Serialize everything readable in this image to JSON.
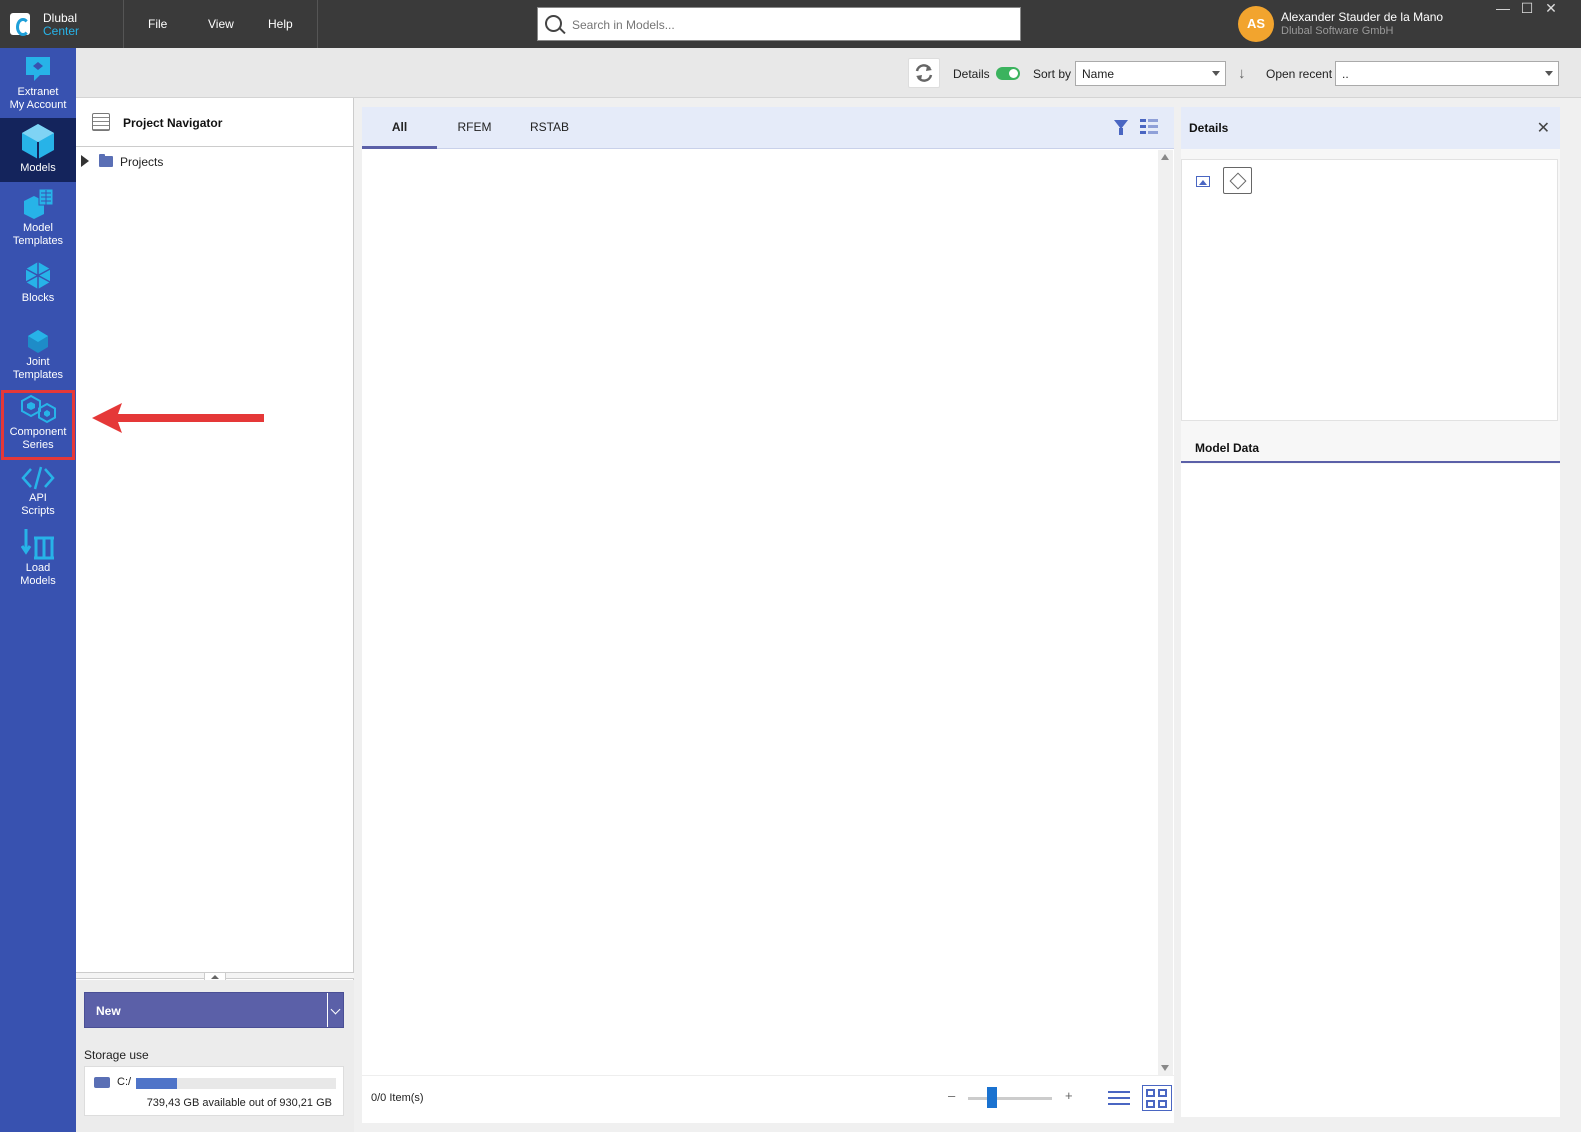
{
  "app": {
    "brand_line1": "Dlubal",
    "brand_line2": "Center"
  },
  "menu": {
    "items": [
      "File",
      "View",
      "Help"
    ]
  },
  "search": {
    "placeholder": "Search in Models...",
    "value": ""
  },
  "user": {
    "initials": "AS",
    "name": "Alexander Stauder de la Mano",
    "org": "Dlubal Software GmbH"
  },
  "window_controls": {
    "minimize": "—",
    "maximize": "☐",
    "close": "✕"
  },
  "sidebar": {
    "items": [
      {
        "label_line1": "Extranet",
        "label_line2": "My Account",
        "icon": "extranet-icon",
        "active": false
      },
      {
        "label_line1": "Models",
        "label_line2": "",
        "icon": "models-cube-icon",
        "active": true
      },
      {
        "label_line1": "Model",
        "label_line2": "Templates",
        "icon": "model-templates-icon",
        "active": false
      },
      {
        "label_line1": "Blocks",
        "label_line2": "",
        "icon": "blocks-icon",
        "active": false
      },
      {
        "label_line1": "Joint",
        "label_line2": "Templates",
        "icon": "joint-templates-icon",
        "active": false
      },
      {
        "label_line1": "Component",
        "label_line2": "Series",
        "icon": "component-series-icon",
        "active": false,
        "highlighted": true
      },
      {
        "label_line1": "API",
        "label_line2": "Scripts",
        "icon": "code-icon",
        "active": false
      },
      {
        "label_line1": "Load",
        "label_line2": "Models",
        "icon": "load-models-icon",
        "active": false
      }
    ]
  },
  "toolbar": {
    "details_label": "Details",
    "details_on": true,
    "sort_label": "Sort by",
    "sort_value": "Name",
    "open_recent_label": "Open recent",
    "open_recent_value": ".."
  },
  "navigator": {
    "title": "Project Navigator",
    "tree": [
      {
        "label": "Projects",
        "expanded": false
      }
    ],
    "new_button": "New",
    "storage_title": "Storage use",
    "storage": {
      "drive": "C:/",
      "used_fraction": 0.205,
      "text": "739,43 GB available out of 930,21 GB"
    }
  },
  "models": {
    "tabs": [
      {
        "label": "All",
        "active": true
      },
      {
        "label": "RFEM",
        "active": false
      },
      {
        "label": "RSTAB",
        "active": false
      }
    ],
    "items_count": "0/0 Item(s)",
    "zoom_minus": "–",
    "zoom_plus": "+",
    "zoom_level": 0.25
  },
  "details": {
    "title": "Details",
    "close": "✕",
    "model_data_title": "Model Data"
  },
  "colors": {
    "sidebar": "#3852b0",
    "sidebar_active": "#14245c",
    "accent": "#5b60a8",
    "toggle_on": "#3bb35e",
    "annotation": "#e53838",
    "brand_cyan": "#27b3e8"
  }
}
